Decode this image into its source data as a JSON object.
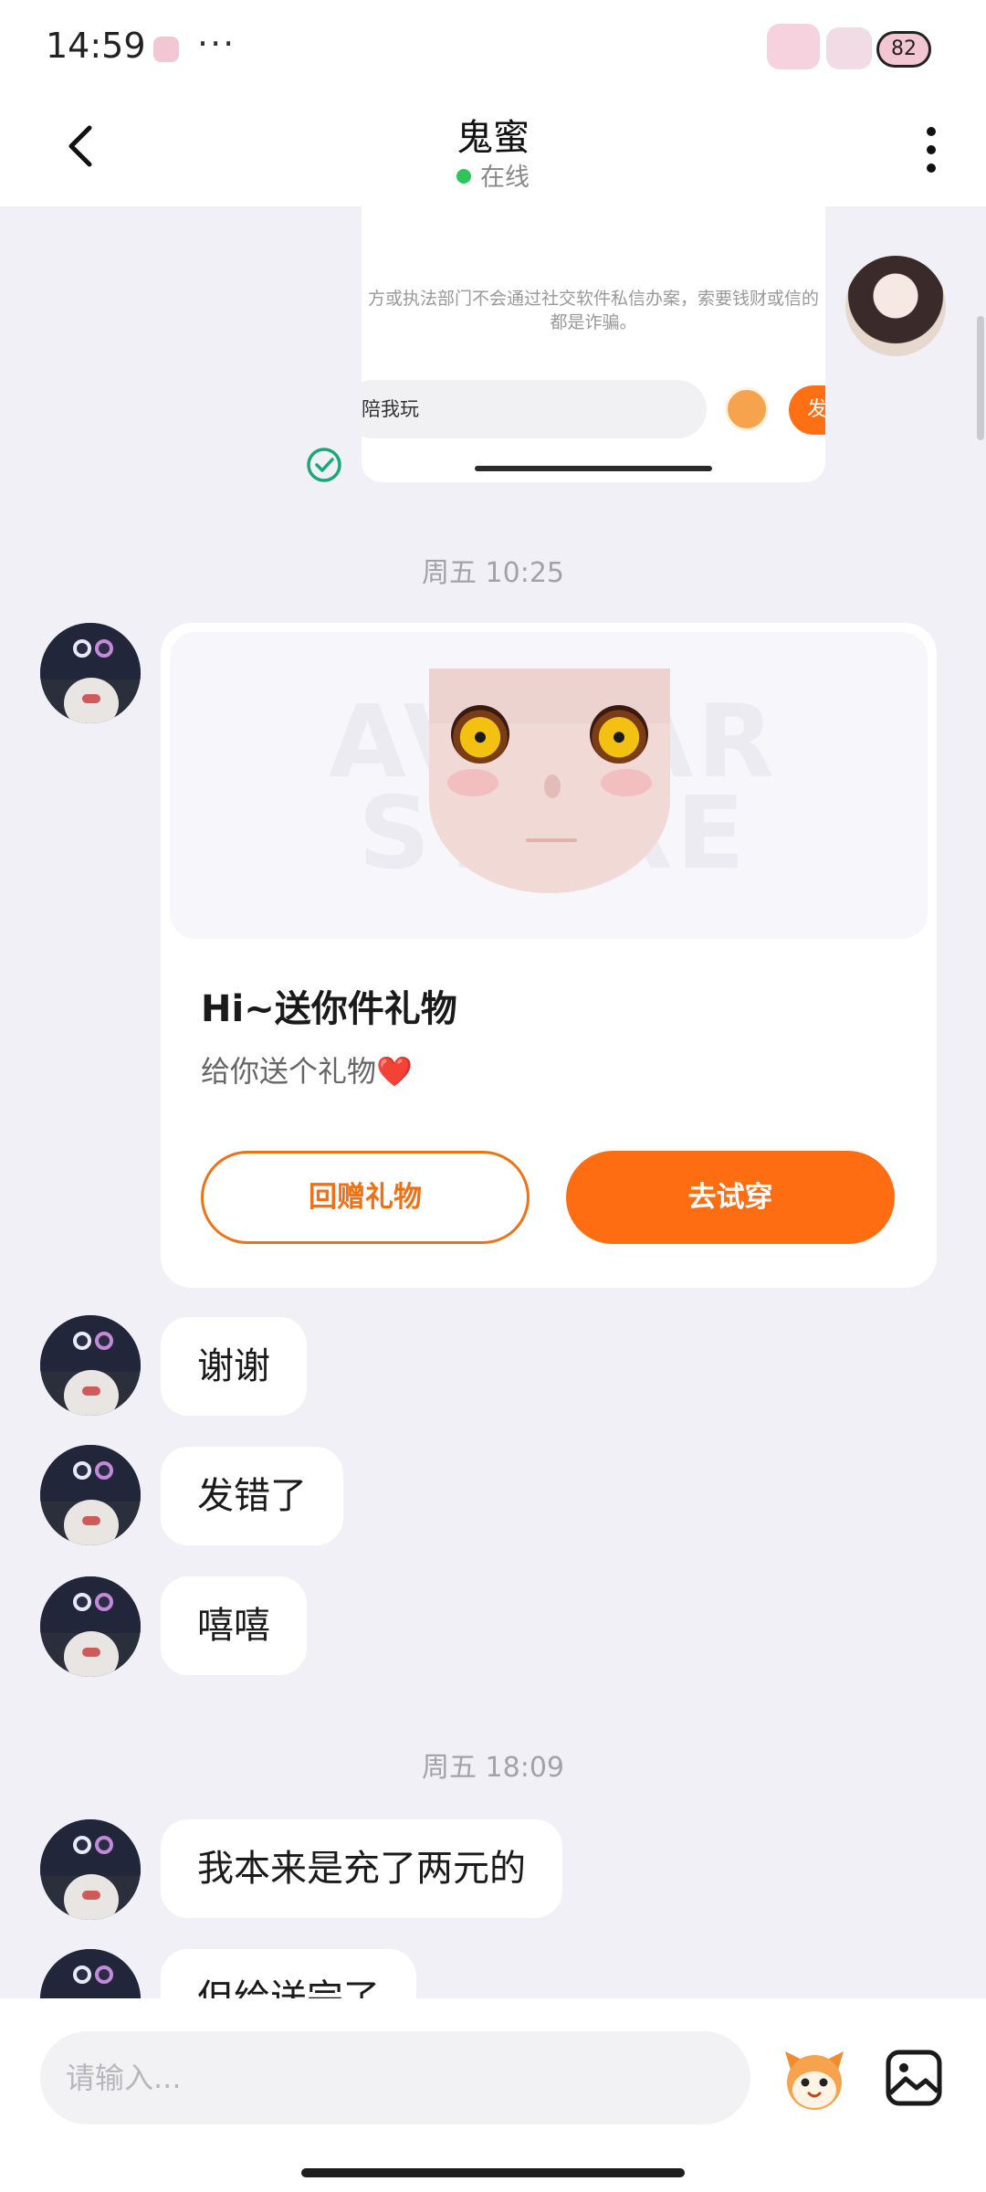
{
  "status_bar": {
    "time": "14:59",
    "dots": "···",
    "battery": "82"
  },
  "header": {
    "title": "鬼蜜",
    "status": "在线"
  },
  "sent_screenshot": {
    "warning": "方或执法部门不会通过社交软件私信办案，索要钱财或信的都是诈骗。",
    "input_text": "陪我玩",
    "send_label": "发"
  },
  "messages": {
    "ts1": "周五 10:25",
    "gift_card": {
      "watermark": "AVATAR STORE",
      "title": "Hi~送你件礼物",
      "subtitle": "给你送个礼物",
      "heart": "❤️",
      "return_button": "回赠礼物",
      "try_button": "去试穿"
    },
    "m1": "谢谢",
    "m2": "发错了",
    "m3": "嘻嘻",
    "ts2": "周五 18:09",
    "m4": "我本来是充了两元的",
    "m5": "但给送完了"
  },
  "input": {
    "placeholder": "请输入..."
  },
  "colors": {
    "accent": "#ff6d12",
    "online": "#2fc45a",
    "background": "#f0f0f6"
  }
}
